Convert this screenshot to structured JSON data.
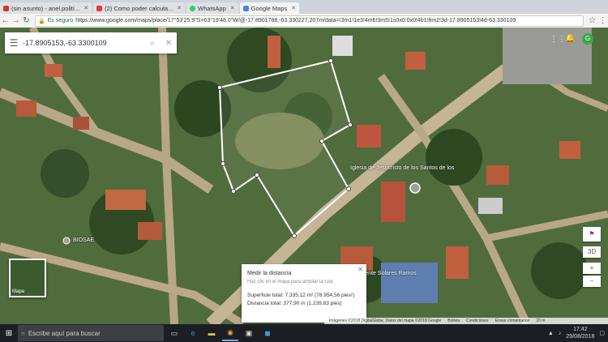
{
  "browser": {
    "tabs": [
      {
        "label": "(sin asunto) - anel.polití...",
        "color": "#d93025"
      },
      {
        "label": "(2) Como poder calcula...",
        "color": "#e53935"
      },
      {
        "label": "WhatsApp",
        "color": "#25d366"
      },
      {
        "label": "Google Maps",
        "color": "#4285f4",
        "active": true
      }
    ],
    "secure_label": "Es seguro",
    "url": "https://www.google.com/maps/place/17°53'25.9\"S+63°19'48.0\"W/@-17.8901788,-63.330227,207m/data=!3m1!1e3!4m6!3m5!1s0x0:0x0!4b1!8m2!3d-17.8905153!4d-63.330109"
  },
  "map": {
    "search_value": "-17.8905153,-63.3300109",
    "labels": {
      "church": "Iglesia de Jesucristo de los Santos de los",
      "school": "Jose Valente Solares Ramos",
      "bioase": "BIOSAE",
      "mapa": "Mapa"
    },
    "measure": {
      "title": "Medir la distancia",
      "subtitle": "Haz clic en el mapa para ampliar la ruta",
      "area": "Superficie total: 7.335,12 m² (78.954,56 pies²)",
      "distance": "Distancia total: 377,90 m (1.239,83 pies)"
    },
    "footer": [
      "Imágenes ©2018 DigitalGlobe, Datos del mapa ©2018 Google",
      "Bolivia",
      "Condiciones",
      "Enviar comentarios",
      "20 m"
    ],
    "controls": {
      "view3d": "3D",
      "zoom_in": "+",
      "zoom_out": "−"
    }
  },
  "taskbar": {
    "search_placeholder": "Escribe aquí para buscar",
    "time": "17:42",
    "date": "29/08/2018"
  }
}
